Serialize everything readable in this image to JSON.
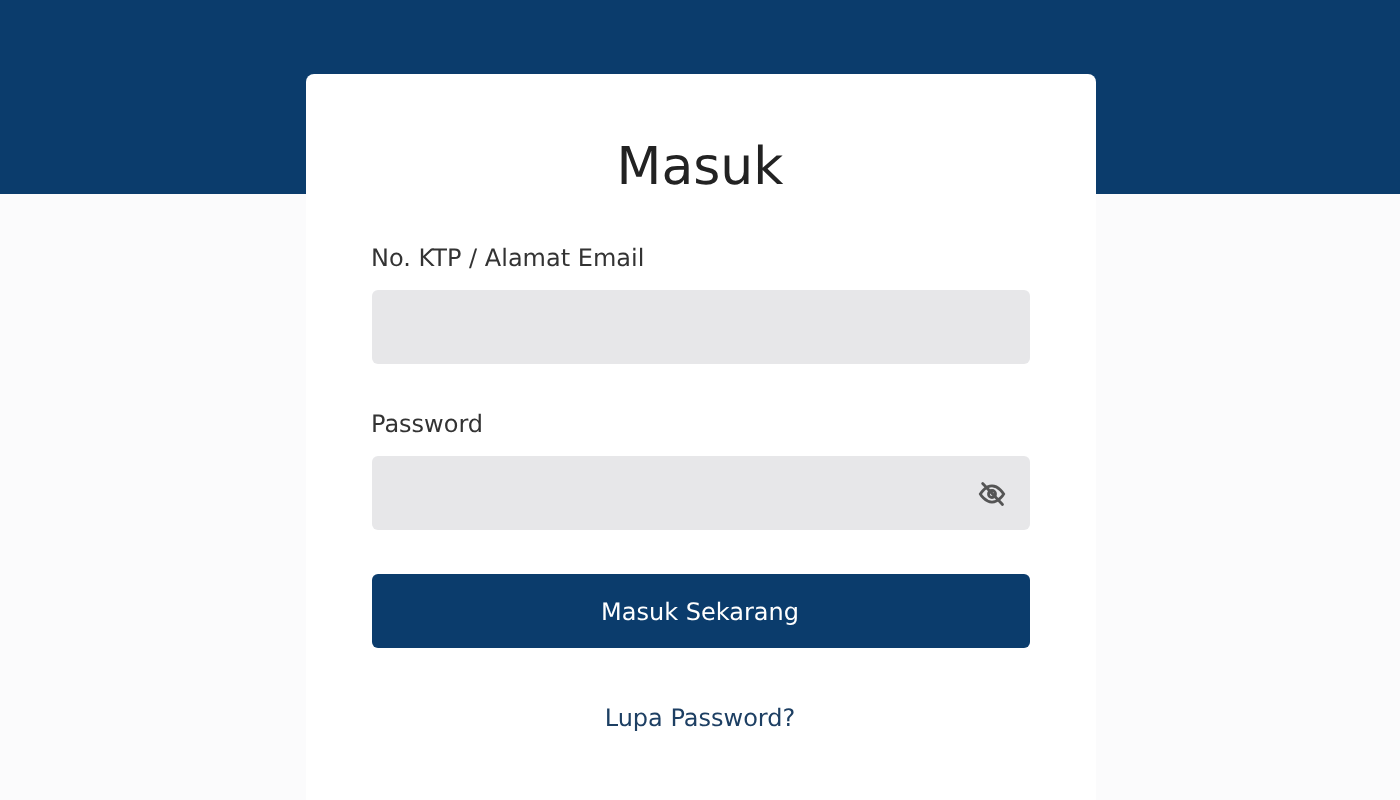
{
  "title": "Masuk",
  "fields": [
    {
      "kind": "text",
      "label": "No. KTP / Alamat Email"
    },
    {
      "kind": "password",
      "label": "Password"
    }
  ],
  "submit": "Masuk Sekarang",
  "forgot_link": "Lupa Password?"
}
